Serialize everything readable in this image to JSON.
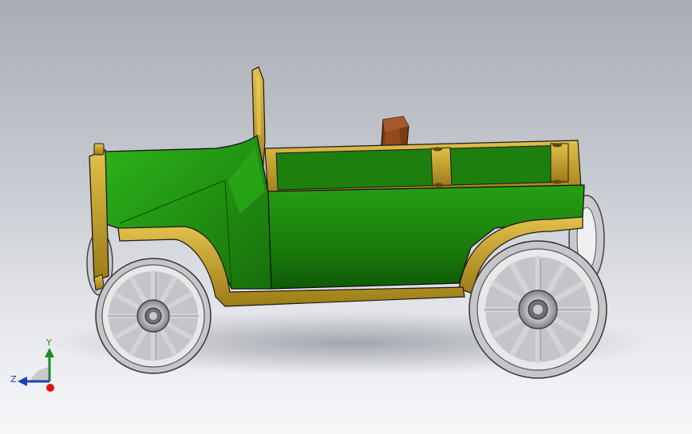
{
  "viewport": {
    "background_top": "#a9acb4",
    "background_bottom": "#f6f7f9"
  },
  "model": {
    "description_icon": "vintage-car-3d-model",
    "colors": {
      "body": "#1f8a10",
      "trim": "#c7a42b",
      "seat": "#7a3a12",
      "wheel": "#d9dadc"
    }
  },
  "triad": {
    "y_label": "Y",
    "z_label": "Z",
    "x_color": "#d11",
    "y_color": "#1c8a2a",
    "z_color": "#1d3fb3"
  }
}
